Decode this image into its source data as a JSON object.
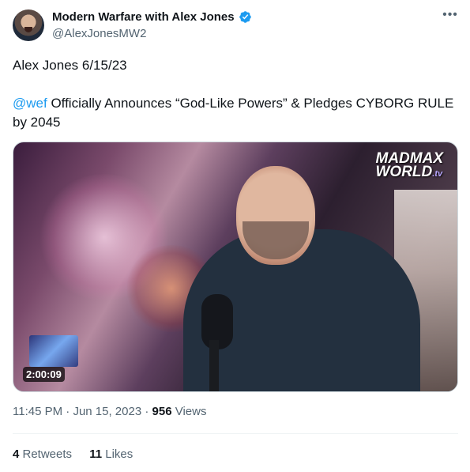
{
  "author": {
    "display_name": "Modern Warfare with Alex Jones",
    "handle": "@AlexJonesMW2",
    "verified": true
  },
  "icons": {
    "verified": "verified-badge-icon",
    "more": "more-horizontal-icon"
  },
  "tweet": {
    "line1": "Alex Jones 6/15/23",
    "mention": "@wef",
    "line2_rest": " Officially Announces “God-Like Powers” & Pledges CYBORG RULE by 2045"
  },
  "media": {
    "logo_line1": "MADMAX",
    "logo_line2": "WORLD",
    "logo_tv": ".tv",
    "duration": "2:00:09"
  },
  "meta": {
    "time": "11:45 PM",
    "separator": " · ",
    "date": "Jun 15, 2023",
    "separator2": " · ",
    "views_count": "956",
    "views_label": " Views"
  },
  "stats": {
    "retweets_count": "4",
    "retweets_label": " Retweets",
    "likes_count": "11",
    "likes_label": " Likes"
  },
  "colors": {
    "link": "#1d9bf0",
    "muted": "#536471",
    "text": "#0f1419"
  }
}
